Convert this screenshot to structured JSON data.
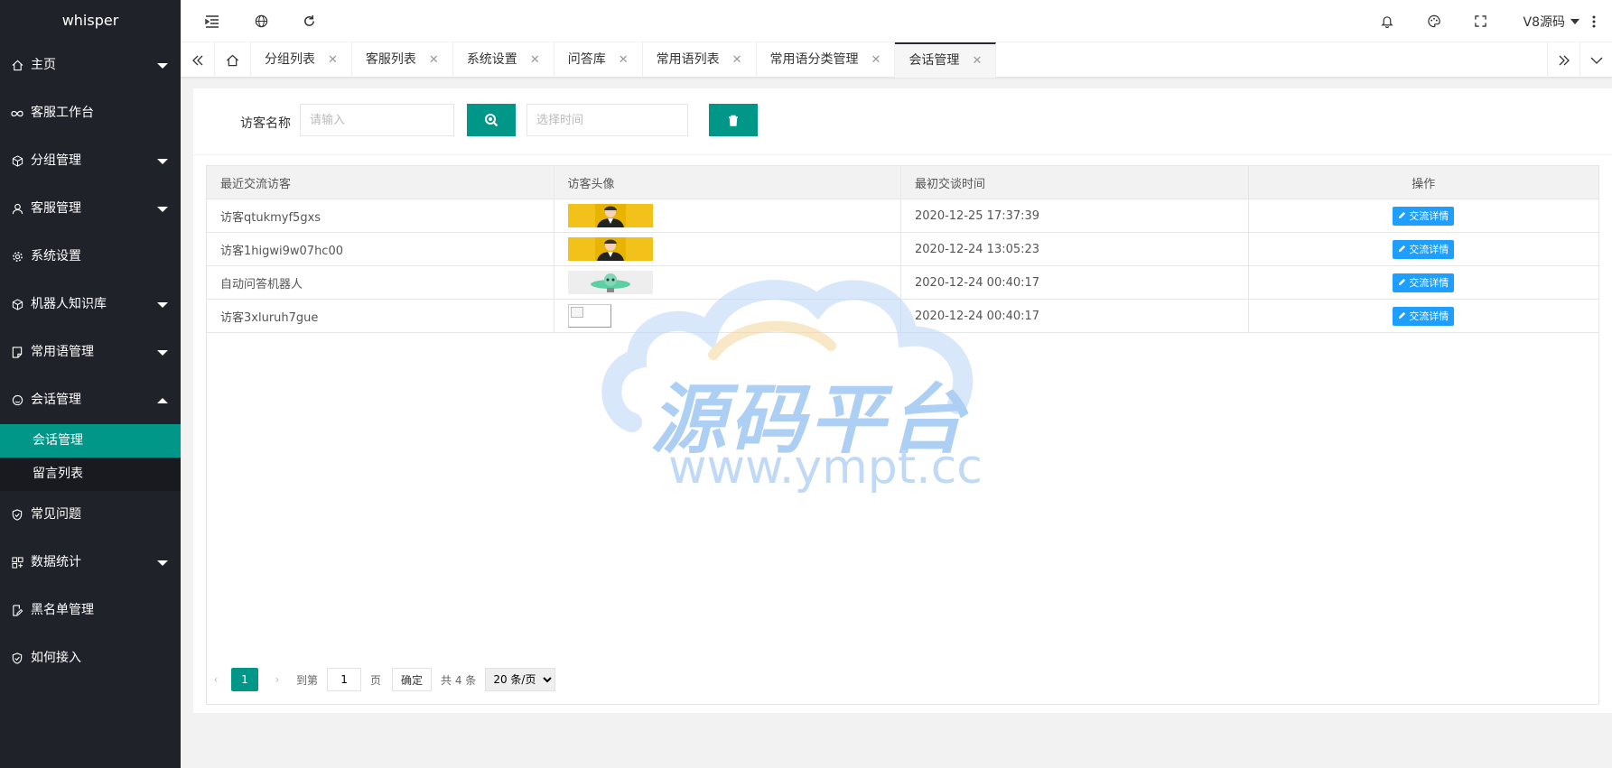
{
  "app": {
    "logo": "whisper"
  },
  "sidebar": {
    "items": [
      {
        "label": "主页",
        "icon": "home-icon",
        "caret": "down"
      },
      {
        "label": "客服工作台",
        "icon": "infinity-icon"
      },
      {
        "label": "分组管理",
        "icon": "cube-icon",
        "caret": "down"
      },
      {
        "label": "客服管理",
        "icon": "user-icon",
        "caret": "down"
      },
      {
        "label": "系统设置",
        "icon": "gear-icon"
      },
      {
        "label": "机器人知识库",
        "icon": "cube-icon",
        "caret": "down"
      },
      {
        "label": "常用语管理",
        "icon": "note-icon",
        "caret": "down"
      },
      {
        "label": "会话管理",
        "icon": "chat-icon",
        "caret": "up"
      },
      {
        "label": "常见问题",
        "icon": "shield-icon"
      },
      {
        "label": "数据统计",
        "icon": "grid-icon",
        "caret": "down"
      },
      {
        "label": "黑名单管理",
        "icon": "edit-icon"
      },
      {
        "label": "如何接入",
        "icon": "shield-icon"
      }
    ],
    "subitems": [
      {
        "label": "会话管理",
        "active": true
      },
      {
        "label": "留言列表",
        "active": false
      }
    ]
  },
  "header": {
    "user": "V8源码"
  },
  "tabs": [
    {
      "label": "分组列表"
    },
    {
      "label": "客服列表"
    },
    {
      "label": "系统设置"
    },
    {
      "label": "问答库"
    },
    {
      "label": "常用语列表"
    },
    {
      "label": "常用语分类管理"
    },
    {
      "label": "会话管理",
      "active": true
    }
  ],
  "search": {
    "label": "访客名称",
    "name_placeholder": "请输入",
    "time_placeholder": "选择时间"
  },
  "table": {
    "headers": [
      "最近交流访客",
      "访客头像",
      "最初交谈时间",
      "操作"
    ],
    "rows": [
      {
        "name": "访客qtukmyf5gxs",
        "avatar": "person",
        "time": "2020-12-25 17:37:39",
        "action": "交流详情"
      },
      {
        "name": "访客1higwi9w07hc00",
        "avatar": "person",
        "time": "2020-12-24 13:05:23",
        "action": "交流详情"
      },
      {
        "name": "自动问答机器人",
        "avatar": "robot",
        "time": "2020-12-24 00:40:17",
        "action": "交流详情"
      },
      {
        "name": "访客3xluruh7gue",
        "avatar": "broken",
        "time": "2020-12-24 00:40:17",
        "action": "交流详情"
      }
    ]
  },
  "pager": {
    "current": "1",
    "goto_label": "到第",
    "goto_value": "1",
    "page_unit": "页",
    "confirm": "确定",
    "total": "共 4 条",
    "page_size": "20 条/页"
  },
  "watermark": {
    "title": "源码平台",
    "url": "www.ympt.cc"
  },
  "colors": {
    "sidebar_bg": "#20222a",
    "accent": "#009688",
    "action_blue": "#1e9fff"
  }
}
